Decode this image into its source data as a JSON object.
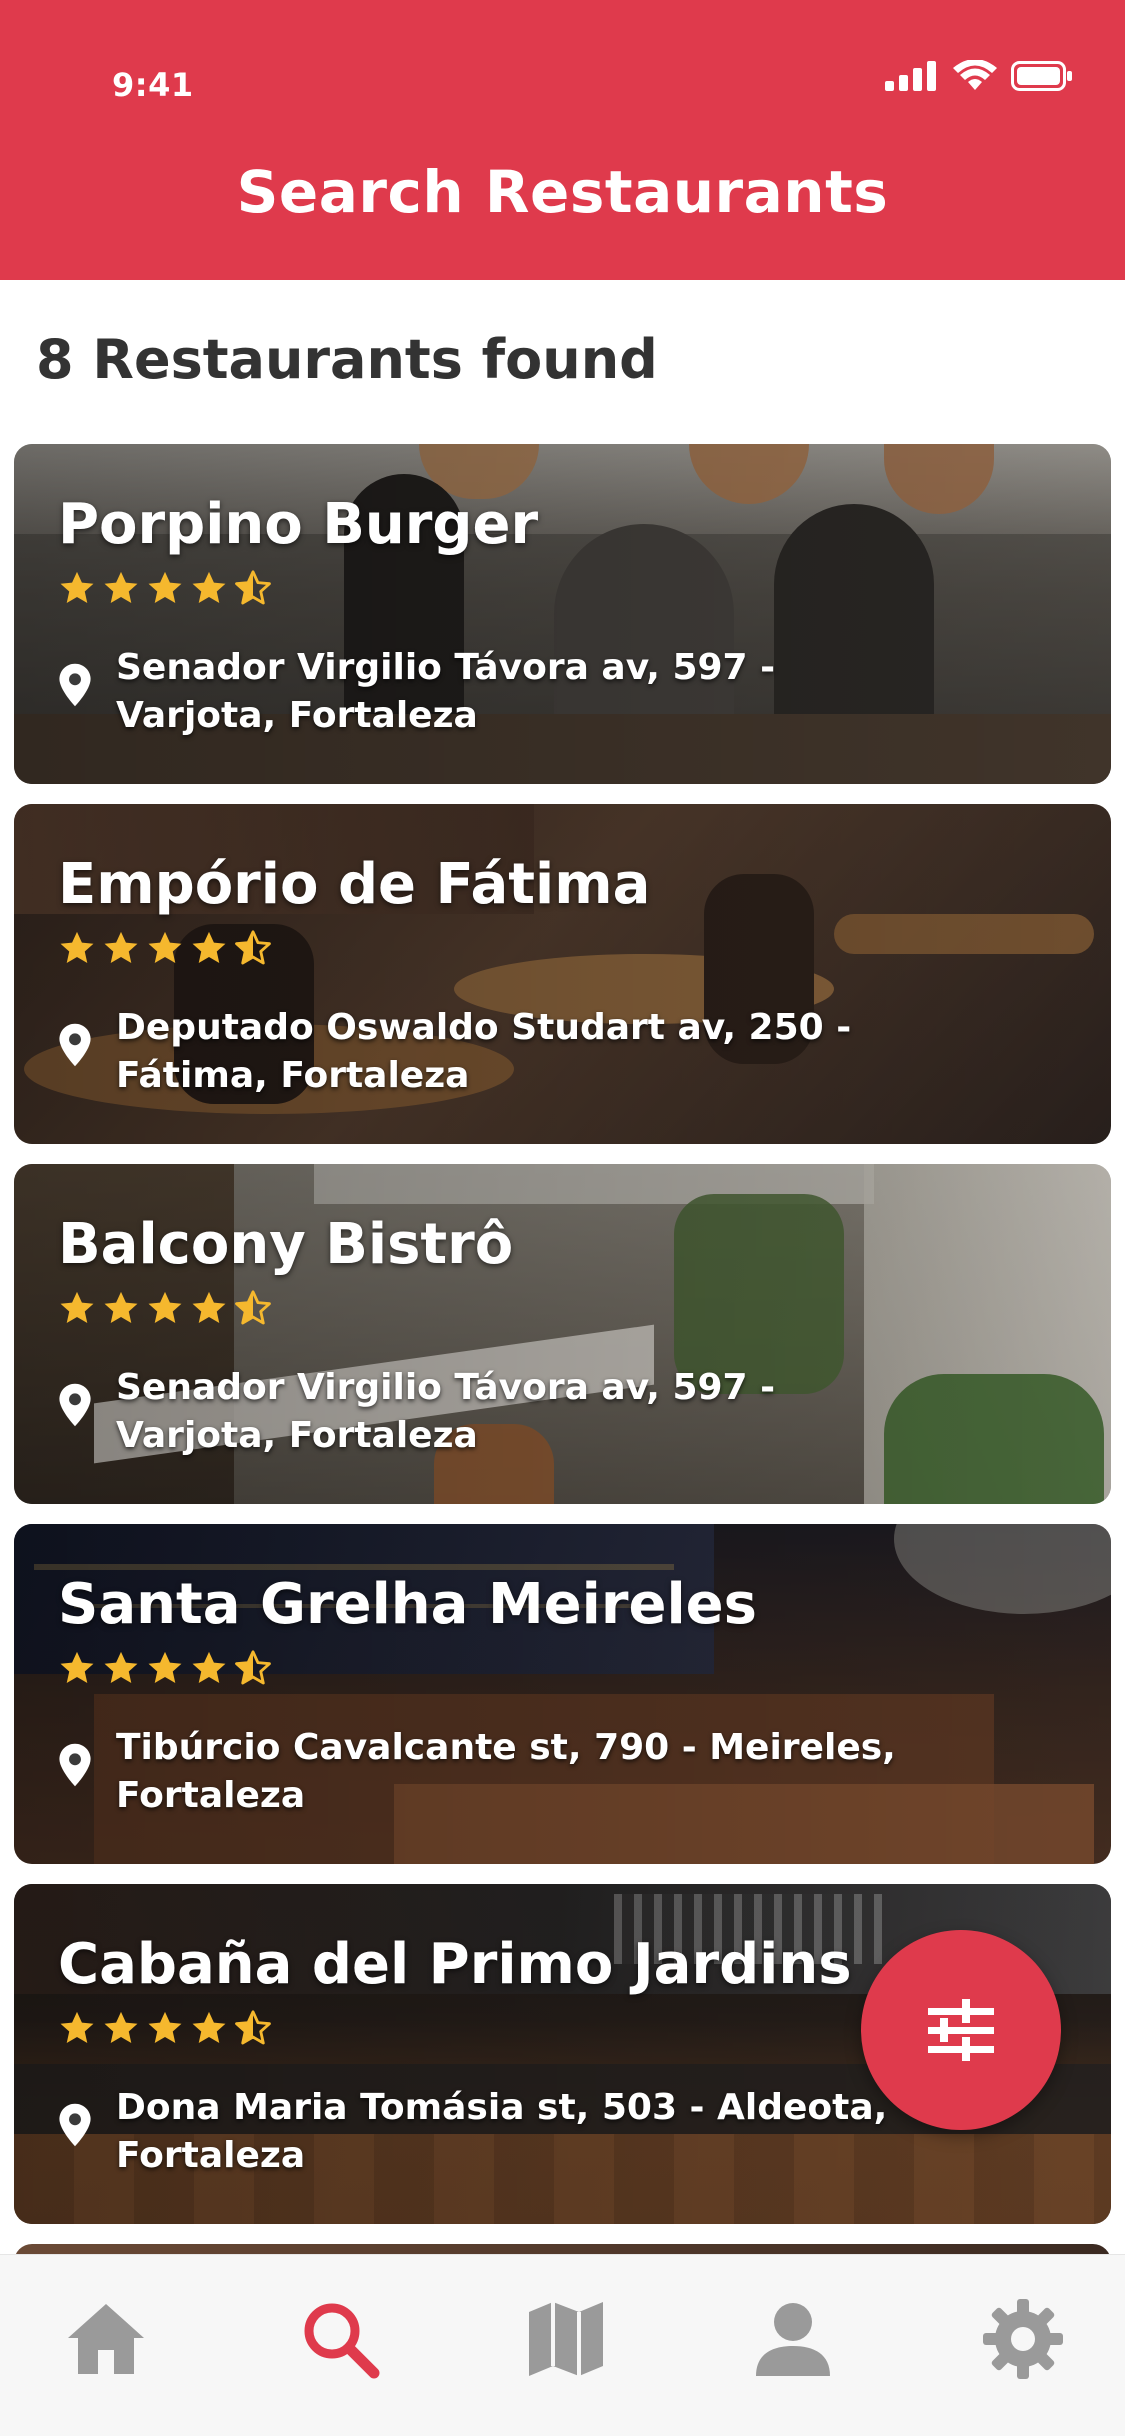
{
  "status_bar": {
    "time": "9:41",
    "icons": [
      "signal-icon",
      "wifi-icon",
      "battery-icon"
    ]
  },
  "header": {
    "title": "Search Restaurants",
    "color": "#df3a4c"
  },
  "results": {
    "count_text": "8 Restaurants found"
  },
  "restaurants": [
    {
      "name": "Porpino Burger",
      "rating": 4.5,
      "address": "Senador Virgilio Távora av, 597 - Varjota, Fortaleza"
    },
    {
      "name": "Empório de Fátima",
      "rating": 4.5,
      "address": "Deputado Oswaldo Studart av, 250 - Fátima, Fortaleza"
    },
    {
      "name": "Balcony Bistrô",
      "rating": 4.5,
      "address": "Senador Virgilio Távora av, 597 - Varjota, Fortaleza"
    },
    {
      "name": "Santa Grelha Meireles",
      "rating": 4.5,
      "address": "Tibúrcio Cavalcante st, 790 - Meireles, Fortaleza"
    },
    {
      "name": "Cabaña del Primo Jardins",
      "rating": 4.5,
      "address": "Dona Maria Tomásia st, 503 - Aldeota, Fortaleza"
    }
  ],
  "filter_button": {
    "icon": "sliders-icon"
  },
  "tab_bar": {
    "tabs": [
      {
        "icon": "home-icon",
        "active": false
      },
      {
        "icon": "search-icon",
        "active": true
      },
      {
        "icon": "map-icon",
        "active": false
      },
      {
        "icon": "user-icon",
        "active": false
      },
      {
        "icon": "gear-icon",
        "active": false
      }
    ],
    "active_color": "#df3a4c",
    "inactive_color": "#9a9a9a"
  },
  "colors": {
    "accent": "#df3a4c",
    "star": "#f5b82e"
  }
}
